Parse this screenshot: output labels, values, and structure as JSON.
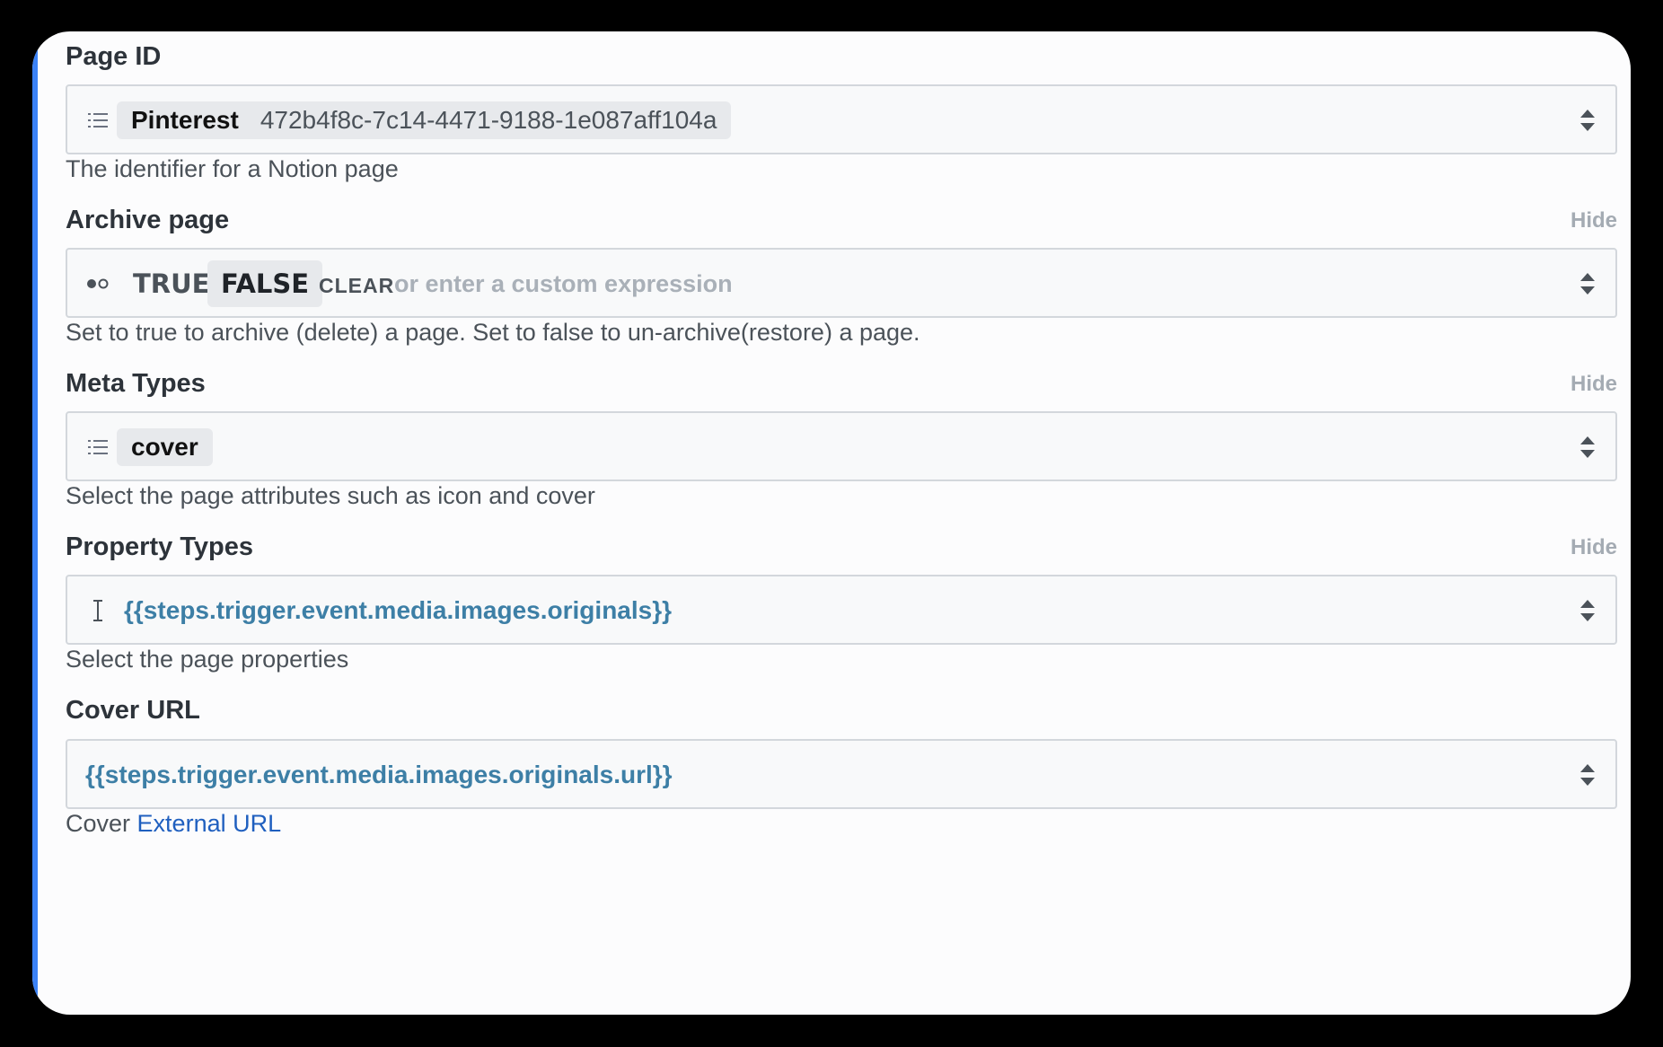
{
  "fields": {
    "page_id": {
      "label": "Page ID",
      "chip_name": "Pinterest",
      "chip_value": "472b4f8c-7c14-4471-9188-1e087aff104a",
      "help": "The identifier for a Notion page"
    },
    "archive_page": {
      "label": "Archive page",
      "hide": "Hide",
      "true_label": "TRUE",
      "false_label": "FALSE",
      "clear_label": "CLEAR",
      "placeholder": "or enter a custom expression",
      "selected": "FALSE",
      "help": "Set to true to archive (delete) a page. Set to false to un-archive(restore) a page."
    },
    "meta_types": {
      "label": "Meta Types",
      "hide": "Hide",
      "chip": "cover",
      "help": "Select the page attributes such as icon and cover"
    },
    "property_types": {
      "label": "Property Types",
      "hide": "Hide",
      "value": "{{steps.trigger.event.media.images.originals}}",
      "help": "Select the page properties"
    },
    "cover_url": {
      "label": "Cover URL",
      "value": "{{steps.trigger.event.media.images.originals.url}}",
      "help_prefix": "Cover",
      "help_link": "External URL"
    }
  },
  "icons": {
    "list": "list-icon",
    "toggle": "toggle-icon",
    "text_cursor": "text-cursor-icon",
    "stepper": "sort-stepper-icon"
  },
  "colors": {
    "accent": "#3b82f6",
    "expression": "#3d7fa6",
    "link": "#1f5fbf"
  }
}
